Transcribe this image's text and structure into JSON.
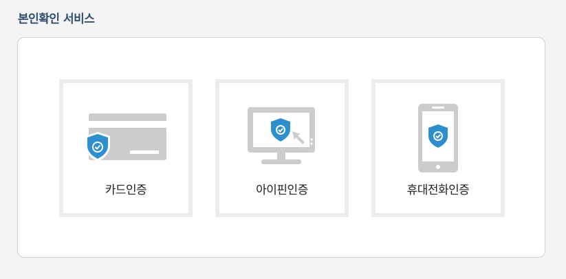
{
  "section": {
    "title": "본인확인 서비스"
  },
  "options": [
    {
      "id": "card",
      "label": "카드인증",
      "icon": "credit-card-shield-icon"
    },
    {
      "id": "ipin",
      "label": "아이핀인증",
      "icon": "monitor-shield-cursor-icon"
    },
    {
      "id": "mobile",
      "label": "휴대전화인증",
      "icon": "smartphone-shield-icon"
    }
  ],
  "colors": {
    "title": "#2f4f70",
    "shield": "#2e8fcf",
    "device_gray": "#cccccc",
    "card_border": "#ececec"
  }
}
